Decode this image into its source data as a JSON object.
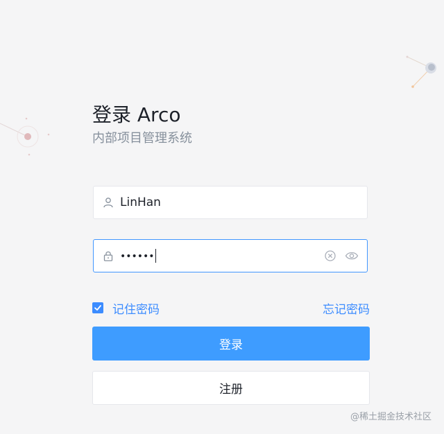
{
  "login": {
    "title": "登录 Arco",
    "subtitle": "内部项目管理系统",
    "username": {
      "value": "LinHan",
      "icon": "user-icon"
    },
    "password": {
      "masked_value": "••••••",
      "icon": "lock-icon",
      "clear_icon": "clear-icon",
      "visibility_icon": "eye-icon"
    },
    "remember_label": "记住密码",
    "remember_checked": true,
    "forgot_label": "忘记密码",
    "login_button": "登录",
    "register_button": "注册"
  },
  "watermark": "@稀土掘金技术社区",
  "colors": {
    "primary": "#3e9cff",
    "link": "#3c8cff",
    "background": "#f5f5f6",
    "focus_border": "#4096ff"
  }
}
